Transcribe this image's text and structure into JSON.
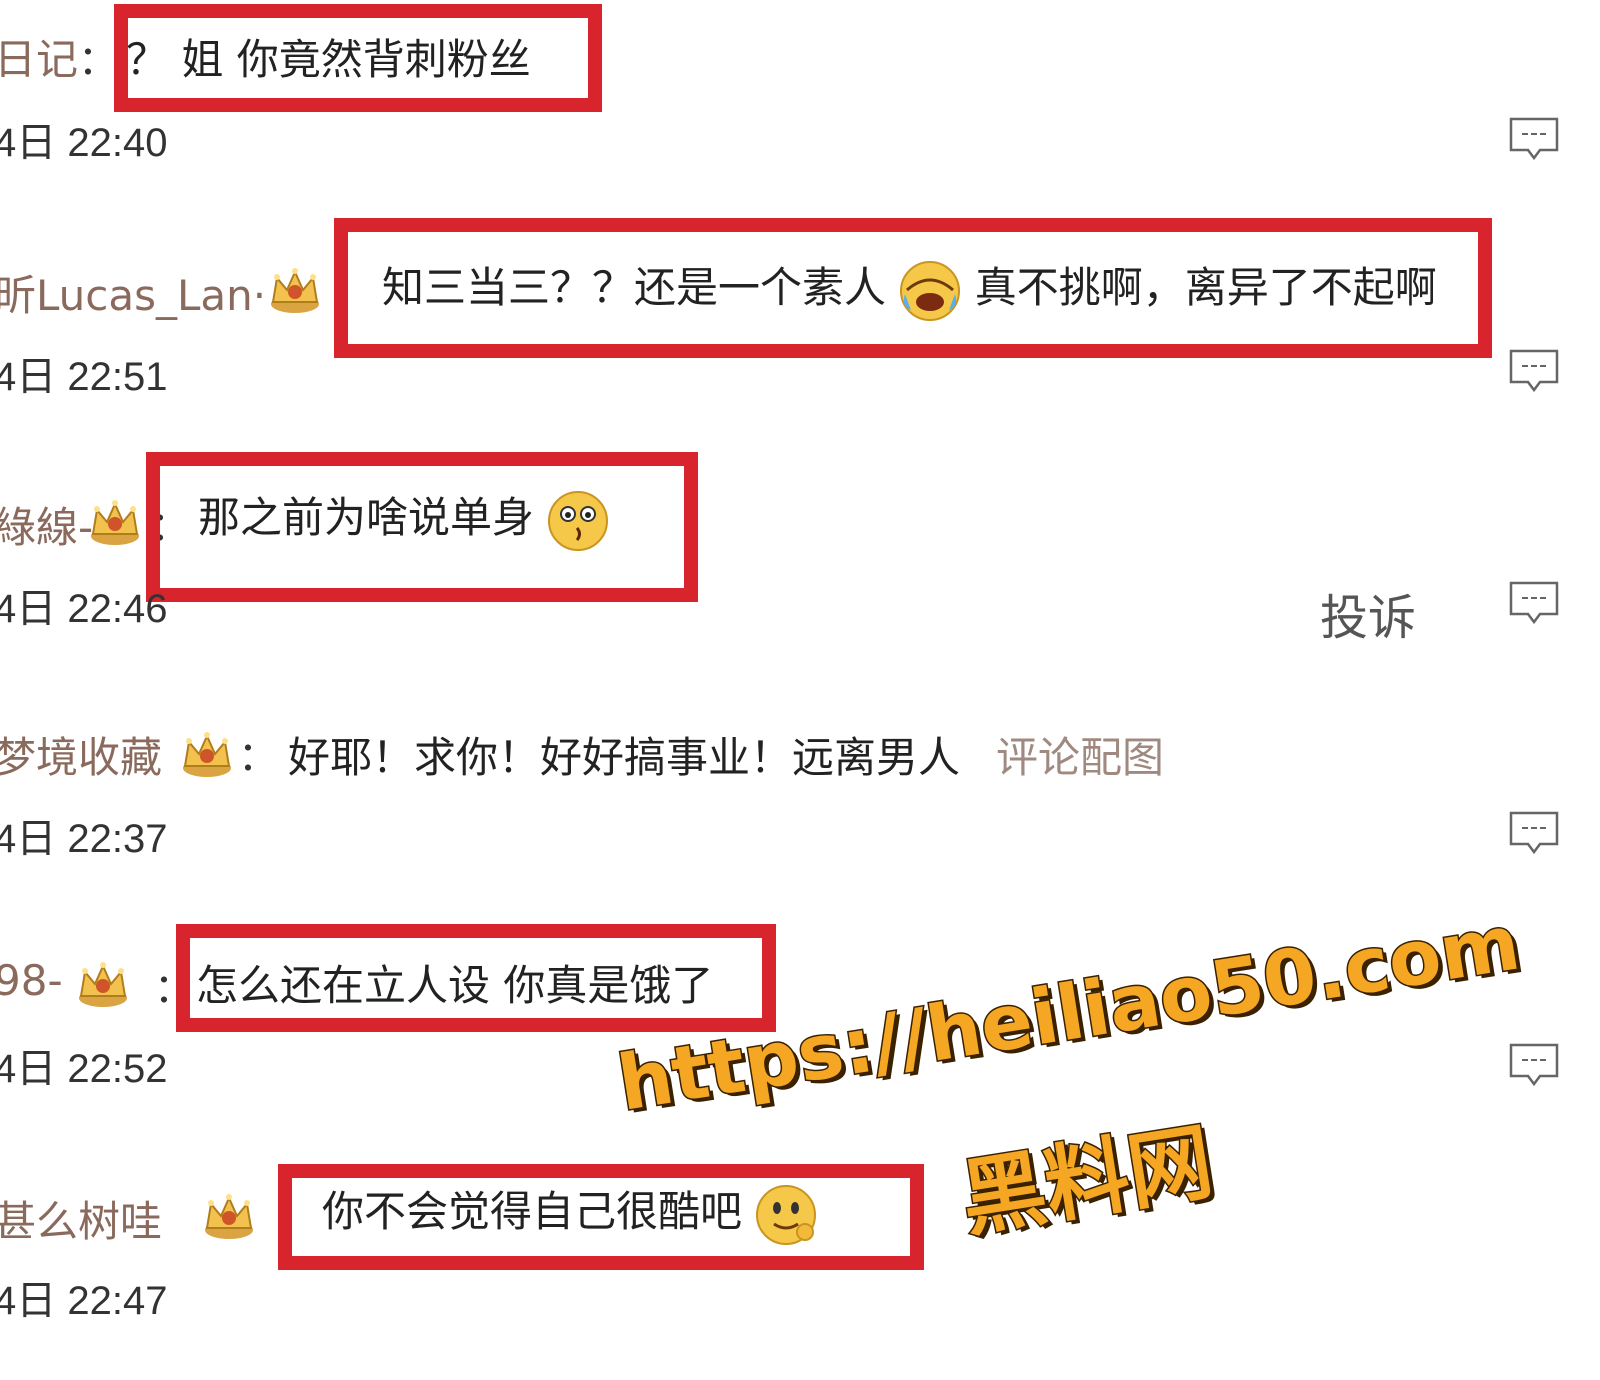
{
  "comments": [
    {
      "user": "日记",
      "colon": "：",
      "text": "？ 姐 你竟然背刺粉丝",
      "time": "4日 22:40"
    },
    {
      "user": "昕Lucas_Lan·",
      "text_a": "知三当三？？还是一个素人",
      "text_b": "真不挑啊，离异了不起啊",
      "time": "4日 22:51"
    },
    {
      "user": "綠線-",
      "colon": "：",
      "text": "那之前为啥说单身",
      "time": "4日 22:46"
    },
    {
      "user": "梦境收藏",
      "colon": "：",
      "text": "好耶！求你！好好搞事业！远离男人",
      "link": "评论配图",
      "time": "4日 22:37"
    },
    {
      "user": "98-",
      "colon": "：",
      "text": "怎么还在立人设 你真是饿了",
      "time": "4日 22:52"
    },
    {
      "user": "甚么树哇",
      "text": "你不会觉得自己很酷吧",
      "time": "4日 22:47"
    }
  ],
  "complain_label": "投诉",
  "watermark": {
    "url": "https://heiliao50.com",
    "site": "黑料网"
  },
  "icons": [
    "reply-icon",
    "crown-badge-icon",
    "laugh-cry-emoji",
    "shocked-emoji",
    "smile-emoji"
  ],
  "colors": {
    "highlight_box": "#d8242c",
    "watermark": "#f5a623"
  }
}
